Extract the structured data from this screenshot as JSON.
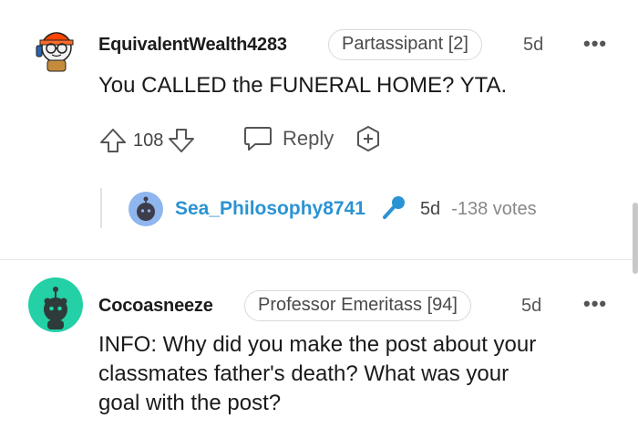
{
  "comments": [
    {
      "username": "EquivalentWealth4283",
      "flair": "Partassipant [2]",
      "time": "5d",
      "more": "•••",
      "body_lines": [
        "You CALLED the FUNERAL HOME? YTA."
      ],
      "upvotes": "108",
      "reply_label": "Reply"
    },
    {
      "username": "Cocoasneeze",
      "flair": "Professor Emeritass [94]",
      "time": "5d",
      "more": "•••",
      "body_lines": [
        "INFO: Why did you make the post about your",
        "classmates father's death? What was your",
        "goal with the post?"
      ]
    }
  ],
  "collapsed_reply": {
    "username": "Sea_Philosophy8741",
    "time": "5d",
    "votes": "-138 votes"
  },
  "colors": {
    "accent_blue": "#2b93d3",
    "text": "#1a1a1b",
    "muted": "#555555",
    "avatar_teal": "#24d0a6"
  }
}
